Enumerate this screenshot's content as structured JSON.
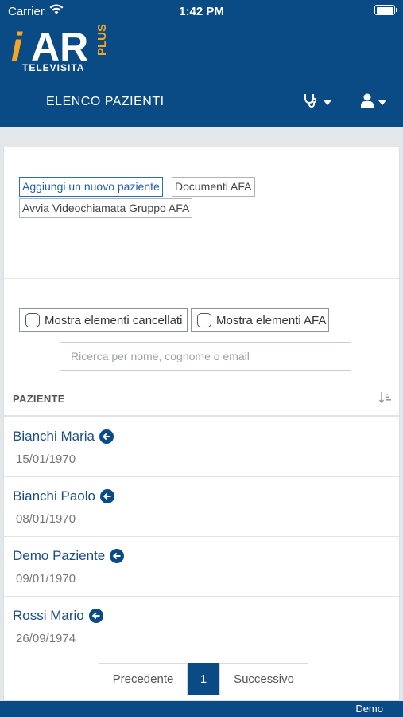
{
  "status_bar": {
    "carrier": "Carrier",
    "time": "1:42 PM"
  },
  "logo": {
    "i": "i",
    "ar": "AR",
    "plus": "PLUS",
    "subtitle": "TELEVISITA"
  },
  "nav": {
    "title": "ELENCO PAZIENTI",
    "stethoscope_icon": "stethoscope-icon",
    "user_icon": "user-icon"
  },
  "actions": {
    "add_patient": "Aggiungi un nuovo paziente",
    "afa_documents": "Documenti AFA",
    "afa_group_video": "Avvia Videochiamata Gruppo AFA"
  },
  "filters": {
    "show_deleted": "Mostra elementi cancellati",
    "show_afa": "Mostra elementi AFA",
    "search_placeholder": "Ricerca per nome, cognome o email"
  },
  "table": {
    "header": "PAZIENTE",
    "rows": [
      {
        "name": "Bianchi Maria",
        "date": "15/01/1970"
      },
      {
        "name": "Bianchi Paolo",
        "date": "08/01/1970"
      },
      {
        "name": "Demo Paziente",
        "date": "09/01/1970"
      },
      {
        "name": "Rossi Mario",
        "date": "26/09/1974"
      }
    ]
  },
  "pagination": {
    "prev": "Precedente",
    "current": "1",
    "next": "Successivo"
  },
  "footer": {
    "text": "Demo"
  },
  "colors": {
    "brand": "#0a4a85",
    "accent": "#f5a623",
    "link": "#1a4d80"
  }
}
